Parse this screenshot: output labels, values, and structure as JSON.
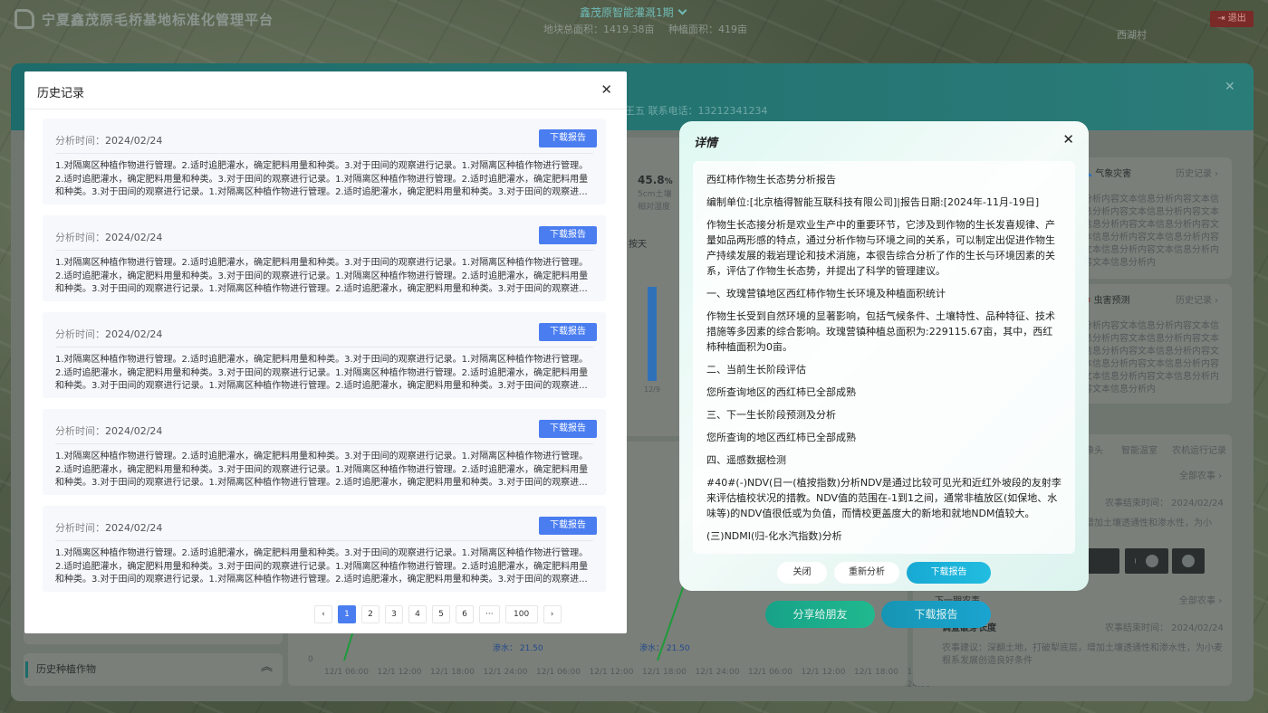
{
  "header": {
    "app_title": "宁夏鑫茂原毛桥基地标准化管理平台",
    "project_name": "鑫茂原智能灌溉1期",
    "total_area": "地块总面积：1419.38亩",
    "planting_area": "种植面积：419亩",
    "logout_label": "退出",
    "village": "西湖村"
  },
  "background": {
    "contact": "王五   联系电话：13212341234",
    "humidity_value": "45.8",
    "humidity_unit": "%",
    "humidity_label": "5cm土壤\n相对湿度",
    "by_day": "按天",
    "bar_label": "12/9",
    "weather_title": "气象灾害",
    "weather_history": "历史记录",
    "weather_text": "分析内容文本信息分析内容文本信息分析内容文本信息分析内容文本信息分析内容文本信息分析内容文本信息分析内容文本信息分析内容文本信息分析内容文本信息分析内容文本信息分析内",
    "pest_title": "虫害预测",
    "pest_history": "历史记录",
    "pest_text": "分析内容文本信息分析内容文本信息分析内容文本信息分析内容文本信息分析内容文本信息分析内容文本信息分析内容文本信息分析内容文本信息分析内容文本信息分析内容文本信息分析内",
    "tabs": [
      "像头",
      "智能温室",
      "农机运行记录"
    ],
    "all_farming_1": "全部农事",
    "farming_end_1": "农事结束时间：  2024/02/24",
    "farming_tip_1": "增加土壤透通性和渗水性，为小",
    "all_farming_2": "全部农事",
    "next_label": "下一期农事",
    "task_title": "调查破芽长度",
    "farming_end_2": "农事结束时间：  2024/02/24",
    "farming_tip_2": "农事建议：深翻土地，打破犁底层，增加土壤透通性和渗水性，为小麦根系发展创造良好条件",
    "history_crop": "历史种植作物",
    "chart_zero": "0",
    "water_a": "渗水：  21.50",
    "water_b": "渗水：  21.50",
    "x_ticks": [
      "12/1 06:00",
      "12/1 12:00",
      "12/1 18:00",
      "12/1 24:00",
      "12/1 06:00",
      "12/1 12:00",
      "12/1 18:00",
      "12/1 24:00",
      "12/1 06:00",
      "12/1 12:00",
      "12/1 18:00",
      "12/1 24:00"
    ],
    "share_label": "分享给朋友",
    "download_label": "下载报告"
  },
  "history": {
    "title": "历史记录",
    "records": [
      {
        "time_label": "分析时间：",
        "time": "2024/02/24",
        "button": "下载报告",
        "text": "1.对隔离区种植作物进行管理。2.适时追肥灌水，确定肥料用量和种类。3.对于田间的观察进行记录。1.对隔离区种植作物进行管理。2.适时追肥灌水，确定肥料用量和种类。3.对于田间的观察进行记录。1.对隔离区种植作物进行管理。2.适时追肥灌水，确定肥料用量和种类。3.对于田间的观察进行记录。1.对隔离区种植作物进行管理。2.适时追肥灌水，确定肥料用量和种类。3.对于田间的观察进..."
      },
      {
        "time_label": "分析时间：",
        "time": "2024/02/24",
        "button": "下载报告",
        "text": "1.对隔离区种植作物进行管理。2.适时追肥灌水，确定肥料用量和种类。3.对于田间的观察进行记录。1.对隔离区种植作物进行管理。2.适时追肥灌水，确定肥料用量和种类。3.对于田间的观察进行记录。1.对隔离区种植作物进行管理。2.适时追肥灌水，确定肥料用量和种类。3.对于田间的观察进行记录。1.对隔离区种植作物进行管理。2.适时追肥灌水，确定肥料用量和种类。3.对于田间的观察进..."
      },
      {
        "time_label": "分析时间：",
        "time": "2024/02/24",
        "button": "下载报告",
        "text": "1.对隔离区种植作物进行管理。2.适时追肥灌水，确定肥料用量和种类。3.对于田间的观察进行记录。1.对隔离区种植作物进行管理。2.适时追肥灌水，确定肥料用量和种类。3.对于田间的观察进行记录。1.对隔离区种植作物进行管理。2.适时追肥灌水，确定肥料用量和种类。3.对于田间的观察进行记录。1.对隔离区种植作物进行管理。2.适时追肥灌水，确定肥料用量和种类。3.对于田间的观察进..."
      },
      {
        "time_label": "分析时间：",
        "time": "2024/02/24",
        "button": "下载报告",
        "text": "1.对隔离区种植作物进行管理。2.适时追肥灌水，确定肥料用量和种类。3.对于田间的观察进行记录。1.对隔离区种植作物进行管理。2.适时追肥灌水，确定肥料用量和种类。3.对于田间的观察进行记录。1.对隔离区种植作物进行管理。2.适时追肥灌水，确定肥料用量和种类。3.对于田间的观察进行记录。1.对隔离区种植作物进行管理。2.适时追肥灌水，确定肥料用量和种类。3.对于田间的观察进..."
      },
      {
        "time_label": "分析时间：",
        "time": "2024/02/24",
        "button": "下载报告",
        "text": "1.对隔离区种植作物进行管理。2.适时追肥灌水，确定肥料用量和种类。3.对于田间的观察进行记录。1.对隔离区种植作物进行管理。2.适时追肥灌水，确定肥料用量和种类。3.对于田间的观察进行记录。1.对隔离区种植作物进行管理。2.适时追肥灌水，确定肥料用量和种类。3.对于田间的观察进行记录。1.对隔离区种植作物进行管理。2.适时追肥灌水，确定肥料用量和种类。3.对于田间的观察进..."
      }
    ],
    "pagination": {
      "prev": "‹",
      "pages": [
        "1",
        "2",
        "3",
        "4",
        "5",
        "6",
        "···",
        "100"
      ],
      "current": "1",
      "next": "›"
    }
  },
  "detail": {
    "title": "详情",
    "paragraphs": [
      "西红柿作物生长态势分析报告",
      "编制单位:[北京植得智能互联科技有限公司]|报告日期:[2024年-11月-19日]",
      "作物生长态接分析是欢业生产中的重要环节，它涉及到作物的生长发喜规律、产量如品两形感的特点，通过分析作物与环境之间的关系，可以制定出促进作物生产持续发展的栽岩理论和技术消施，本很告综合分析了作的生长与环境因素的关系，评估了作物生长态势，并提出了科学的管理建议。",
      "一、玫瑰营镇地区西红柿作物生长环境及种植面积统计",
      "作物生长受到自然环境的显著影响，包括气候条件、土壤特性、品种特征、技术措施等多因素的综合影响。玫瑰营镇种植总面积为:229115.67亩，其中，西红柿种植面积为0亩。",
      "二、当前生长阶段评估",
      "您所查询地区的西红柿已全部成熟",
      "三、下一生长阶段预测及分析",
      "您所查询的地区西红柿已全部成熟",
      "四、遥感数据检测",
      "#40#(-)NDV(日一(植按指数)分析NDV是通过比较可见光和近红外坡段的友射李来评估植校状况的措教。NDV值的范围在-1到1之间，通常非植放区(如保地、水味等)的NDV值很低或为负值，而情校更盖度大的新地和就地NDM值较大。",
      "(三)NDMI(归-化水汽指数)分析"
    ],
    "buttons": {
      "close": "关闭",
      "reanalyze": "重新分析",
      "download": "下载报告"
    }
  },
  "colors": {
    "primary_blue": "#4a7df0",
    "teal_header": "#1d6b6a",
    "share_green": "#17a288",
    "download_cyan": "#1aa4d0"
  }
}
